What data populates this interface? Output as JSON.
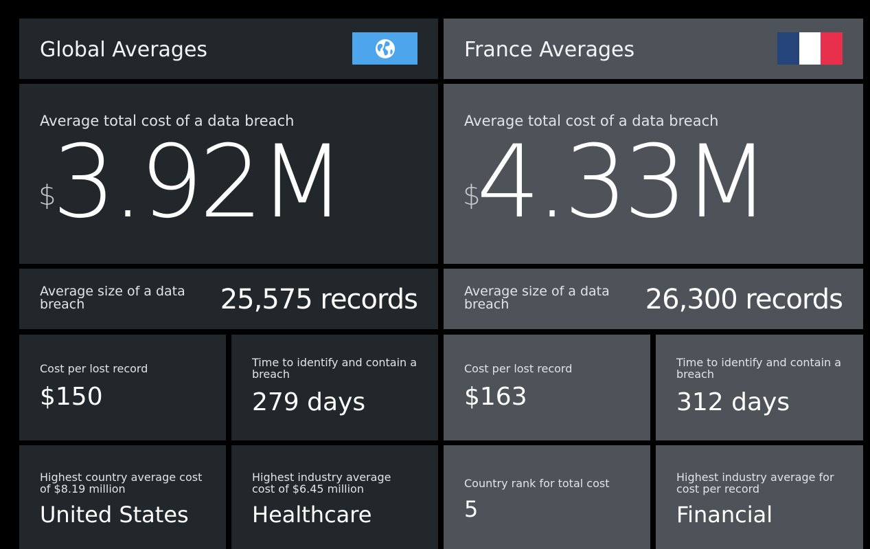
{
  "global": {
    "title": "Global Averages",
    "icon": "globe-icon",
    "badge_color": "#4da6ec",
    "total_cost_label": "Average total cost of a data breach",
    "total_cost_currency": "$",
    "total_cost_value": "3.92M",
    "size_label": "Average size of a data breach",
    "size_value": "25,575 records",
    "cost_per_record_label": "Cost per lost record",
    "cost_per_record_value": "$150",
    "time_label": "Time to identify and contain a breach",
    "time_value": "279 days",
    "country_label": "Highest country average cost of $8.19 million",
    "country_value": "United States",
    "industry_label": "Highest industry average cost of $6.45 million",
    "industry_value": "Healthcare"
  },
  "france": {
    "title": "France Averages",
    "flag_colors": [
      "#24447a",
      "#ffffff",
      "#e8304d"
    ],
    "total_cost_label": "Average total cost of a data breach",
    "total_cost_currency": "$",
    "total_cost_value": "4.33M",
    "size_label": "Average size of a data breach",
    "size_value": "26,300 records",
    "cost_per_record_label": "Cost per lost record",
    "cost_per_record_value": "$163",
    "time_label": "Time to identify and contain a breach",
    "time_value": "312 days",
    "rank_label": "Country rank for total cost",
    "rank_value": "5",
    "industry_label": "Highest industry average for cost per record",
    "industry_value": "Financial"
  },
  "colors": {
    "global_tile": "#21272a",
    "france_tile": "#4d5358",
    "background": "#000000"
  }
}
